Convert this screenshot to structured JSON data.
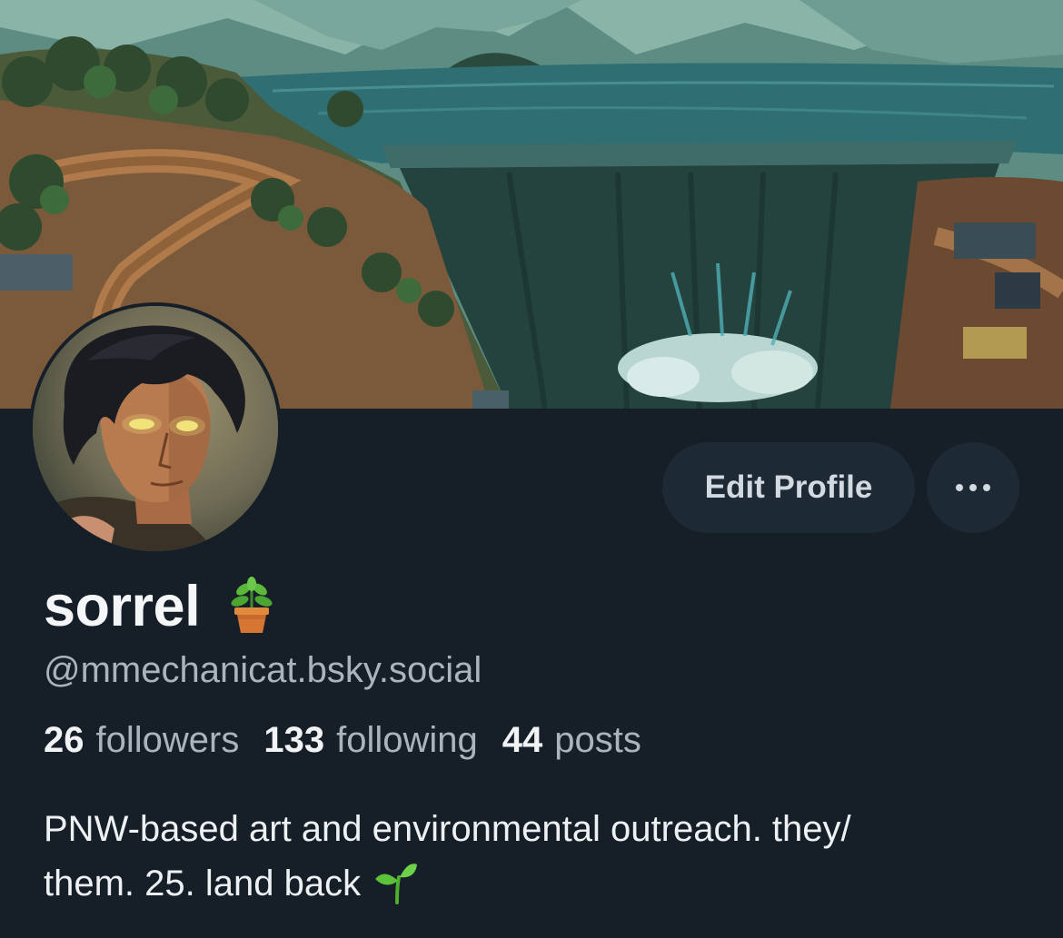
{
  "profile": {
    "display_name": "sorrel",
    "name_icon": "potted-plant-icon",
    "handle": "@mmechanicat.bsky.social",
    "edit_profile_label": "Edit Profile",
    "more_icon": "ellipsis-icon",
    "stats": {
      "followers_count": "26",
      "followers_label": "followers",
      "following_count": "133",
      "following_label": "following",
      "posts_count": "44",
      "posts_label": "posts"
    },
    "bio": {
      "line1": "PNW-based art and environmental outreach. they/",
      "line2": "them. 25. land back",
      "trailing_icon": "seedling-icon"
    }
  },
  "colors": {
    "background": "#161e27",
    "button_bg": "#1e2936",
    "muted_text": "#aab4bf",
    "primary_text": "#f1f3f5"
  }
}
